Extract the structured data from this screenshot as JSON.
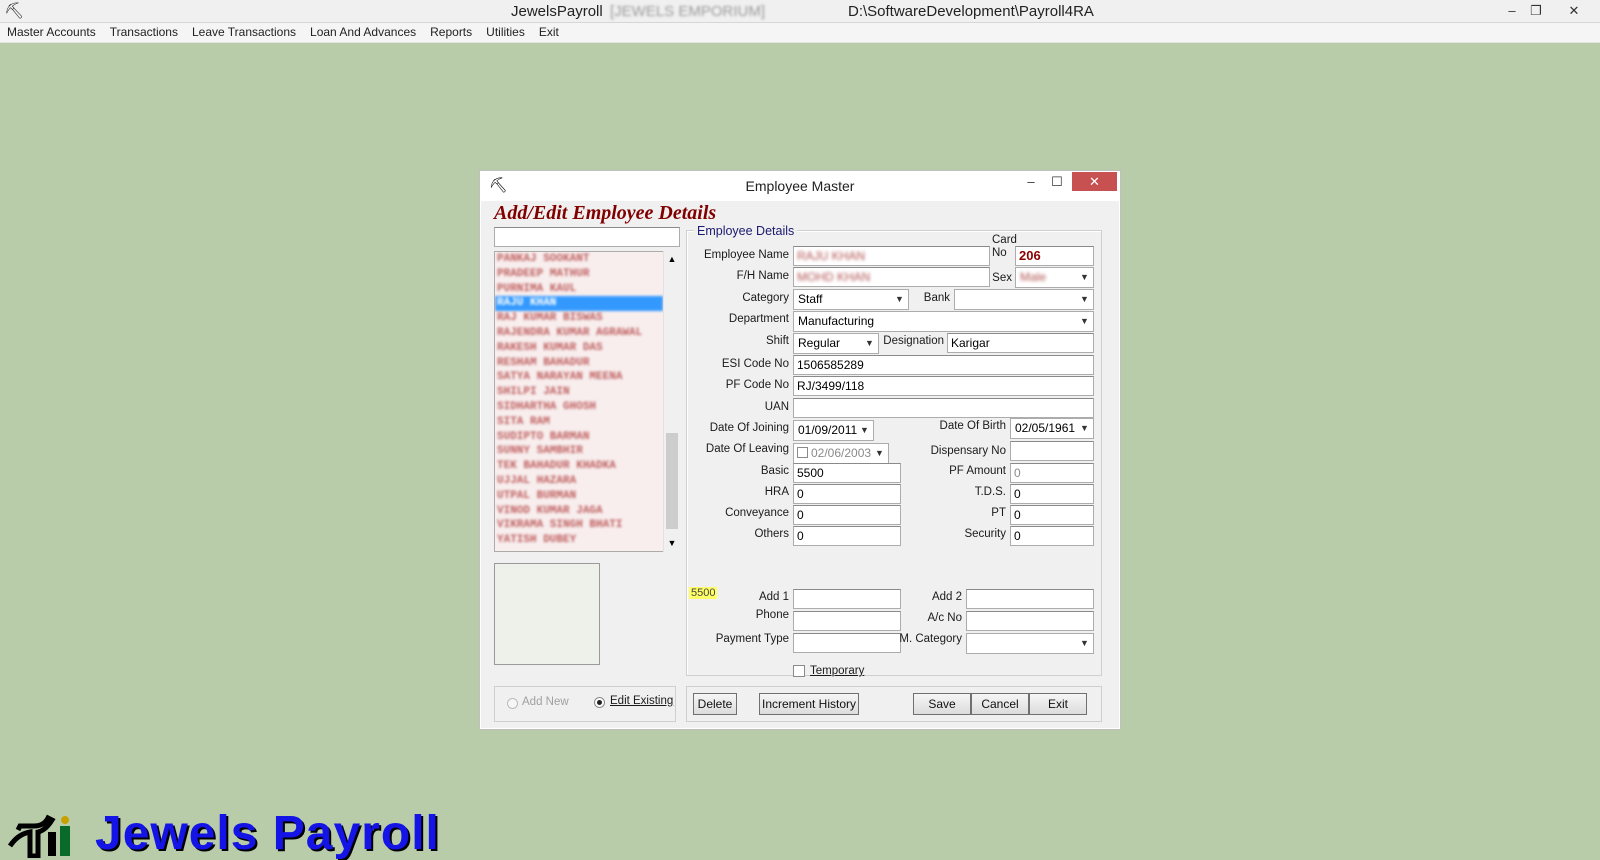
{
  "app": {
    "title": "JewelsPayroll",
    "company": "[JEWELS EMPORIUM]",
    "path": "D:\\SoftwareDevelopment\\Payroll4RA",
    "logo_text": "Jewels Payroll"
  },
  "window_buttons": {
    "minimize": "–",
    "restore": "❐",
    "close": "✕"
  },
  "menu": [
    "Master Accounts",
    "Transactions",
    "Leave Transactions",
    "Loan And Advances",
    "Reports",
    "Utilities",
    "Exit"
  ],
  "dialog": {
    "title": "Employee Master",
    "heading": "Add/Edit Employee Details",
    "search_value": "",
    "group_title": "Employee Details",
    "employees": [
      "PANKAJ SOOKANT",
      "PRADEEP MATHUR",
      "PURNIMA KAUL",
      "RAJU KHAN",
      "RAJ KUMAR BISWAS",
      "RAJENDRA KUMAR AGRAWAL",
      "RAKESH KUMAR DAS",
      "RESHAM BAHADUR",
      "SATYA NARAYAN MEENA",
      "SHILPI JAIN",
      "SIDHARTHA GHOSH",
      "SITA RAM",
      "SUDIPTO BARMAN",
      "SUNNY SAMBHIR",
      "TEK BAHADUR KHADKA",
      "UJJAL HAZARA",
      "UTPAL BURMAN",
      "VINOD KUMAR JAGA",
      "VIKRAMA SINGH BHATI",
      "YATISH DUBEY"
    ],
    "selected_employee_index": 3,
    "labels": {
      "employee_name": "Employee Name",
      "fh_name": "F/H Name",
      "card_no": "Card No",
      "sex": "Sex",
      "category": "Category",
      "bank": "Bank",
      "department": "Department",
      "shift": "Shift",
      "designation": "Designation",
      "esi_code": "ESI Code No",
      "pf_code": "PF Code No",
      "uan": "UAN",
      "date_of_joining": "Date Of Joining",
      "date_of_birth": "Date Of Birth",
      "date_of_leaving": "Date Of Leaving",
      "dispensary_no": "Dispensary No",
      "basic": "Basic",
      "pf_amount": "PF Amount",
      "hra": "HRA",
      "tds": "T.D.S.",
      "conveyance": "Conveyance",
      "pt": "PT",
      "others": "Others",
      "security": "Security",
      "add1": "Add 1",
      "add2": "Add 2",
      "phone": "Phone",
      "ac_no": "A/c No",
      "payment_type": "Payment Type",
      "m_category": "M. Category",
      "temporary": "Temporary"
    },
    "values": {
      "employee_name": "RAJU KHAN",
      "fh_name": "MOHD KHAN",
      "card_no": "206",
      "sex": "Male",
      "category": "Staff",
      "bank": "",
      "department": "Manufacturing",
      "shift": "Regular",
      "designation": "Karigar",
      "esi_code": "1506585289",
      "pf_code": "RJ/3499/118",
      "uan": "",
      "date_of_joining": "01/09/2011",
      "date_of_birth": "02/05/1961",
      "date_of_leaving": "02/06/2003",
      "dispensary_no": "",
      "basic": "5500",
      "pf_amount": "0",
      "hra": "0",
      "tds": "0",
      "conveyance": "0",
      "pt": "0",
      "others": "0",
      "security": "0",
      "add1": "",
      "add2": "",
      "phone": "",
      "ac_no": "",
      "payment_type": "",
      "m_category": "",
      "gross_total": "5500"
    },
    "mode": {
      "add_new": "Add New",
      "edit_existing": "Edit Existing",
      "selected": "edit_existing"
    },
    "buttons": {
      "delete": "Delete",
      "increment_history": "Increment History",
      "save": "Save",
      "cancel": "Cancel",
      "exit": "Exit"
    },
    "temporary_checked": false
  }
}
